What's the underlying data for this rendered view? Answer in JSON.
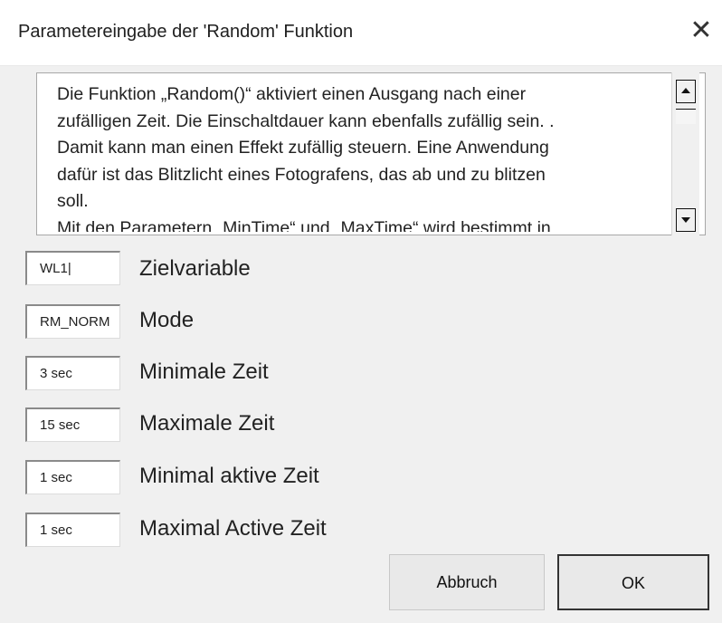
{
  "window": {
    "title": "Parametereingabe der 'Random' Funktion",
    "close_label": "✕"
  },
  "description": {
    "text": "Die Funktion „Random()“ aktiviert einen Ausgang nach einer\nzufälligen Zeit. Die Einschaltdauer kann ebenfalls zufällig sein. .\nDamit kann man einen Effekt zufällig steuern. Eine Anwendung\ndafür ist das Blitzlicht eines Fotografens, das ab und zu blitzen\nsoll.\nMit den Parametern „MinTime“ und „MaxTime“ wird bestimmt in"
  },
  "fields": [
    {
      "value": "WL1|",
      "label": "Zielvariable"
    },
    {
      "value": "RM_NORM",
      "label": "Mode"
    },
    {
      "value": "3 sec",
      "label": "Minimale Zeit"
    },
    {
      "value": "15 sec",
      "label": "Maximale Zeit"
    },
    {
      "value": "1 sec",
      "label": "Minimal aktive Zeit"
    },
    {
      "value": "1 sec",
      "label": "Maximal Active Zeit"
    }
  ],
  "buttons": {
    "cancel_label": "Abbruch",
    "ok_label": "OK"
  }
}
